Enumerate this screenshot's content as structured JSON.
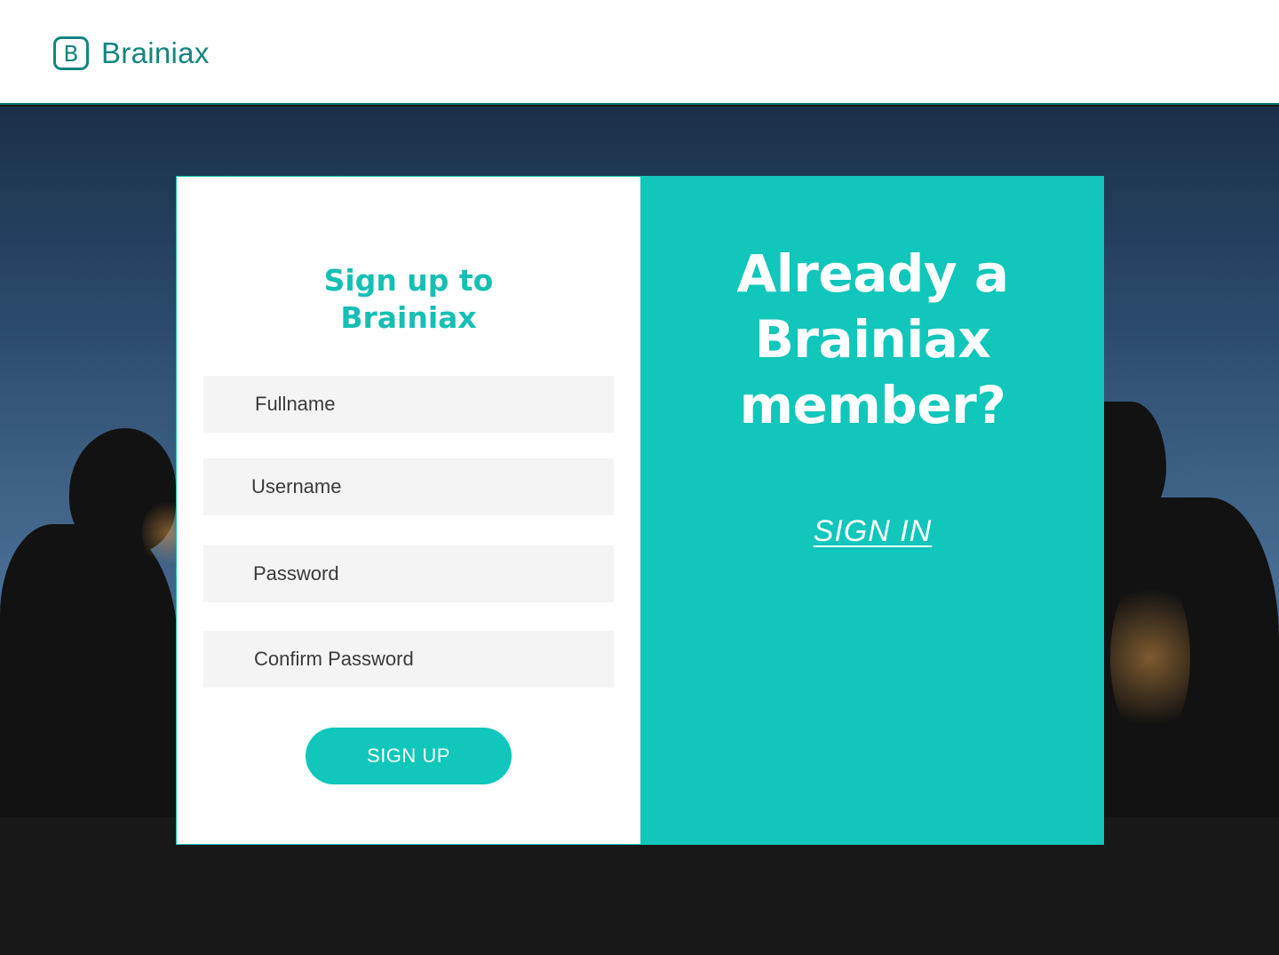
{
  "header": {
    "brand_letter": "B",
    "brand_name": "Brainiax",
    "brand_color": "#13857f"
  },
  "signup": {
    "title_line1": "Sign up to",
    "title_line2": "Brainiax",
    "fields": {
      "fullname_placeholder": "Fullname",
      "username_placeholder": "Username",
      "password_placeholder": "Password",
      "confirm_password_placeholder": "Confirm Password"
    },
    "submit_label": "SIGN UP"
  },
  "signin_panel": {
    "title_line1": "Already a",
    "title_line2": "Brainiax",
    "title_line3": "member?",
    "link_label": "SIGN IN"
  },
  "colors": {
    "accent": "#11c6ba",
    "field_background": "#f4f4f4",
    "card_left_background": "#ffffff"
  },
  "icons": {
    "brand_logo": "rounded-square-letter-b-icon"
  }
}
